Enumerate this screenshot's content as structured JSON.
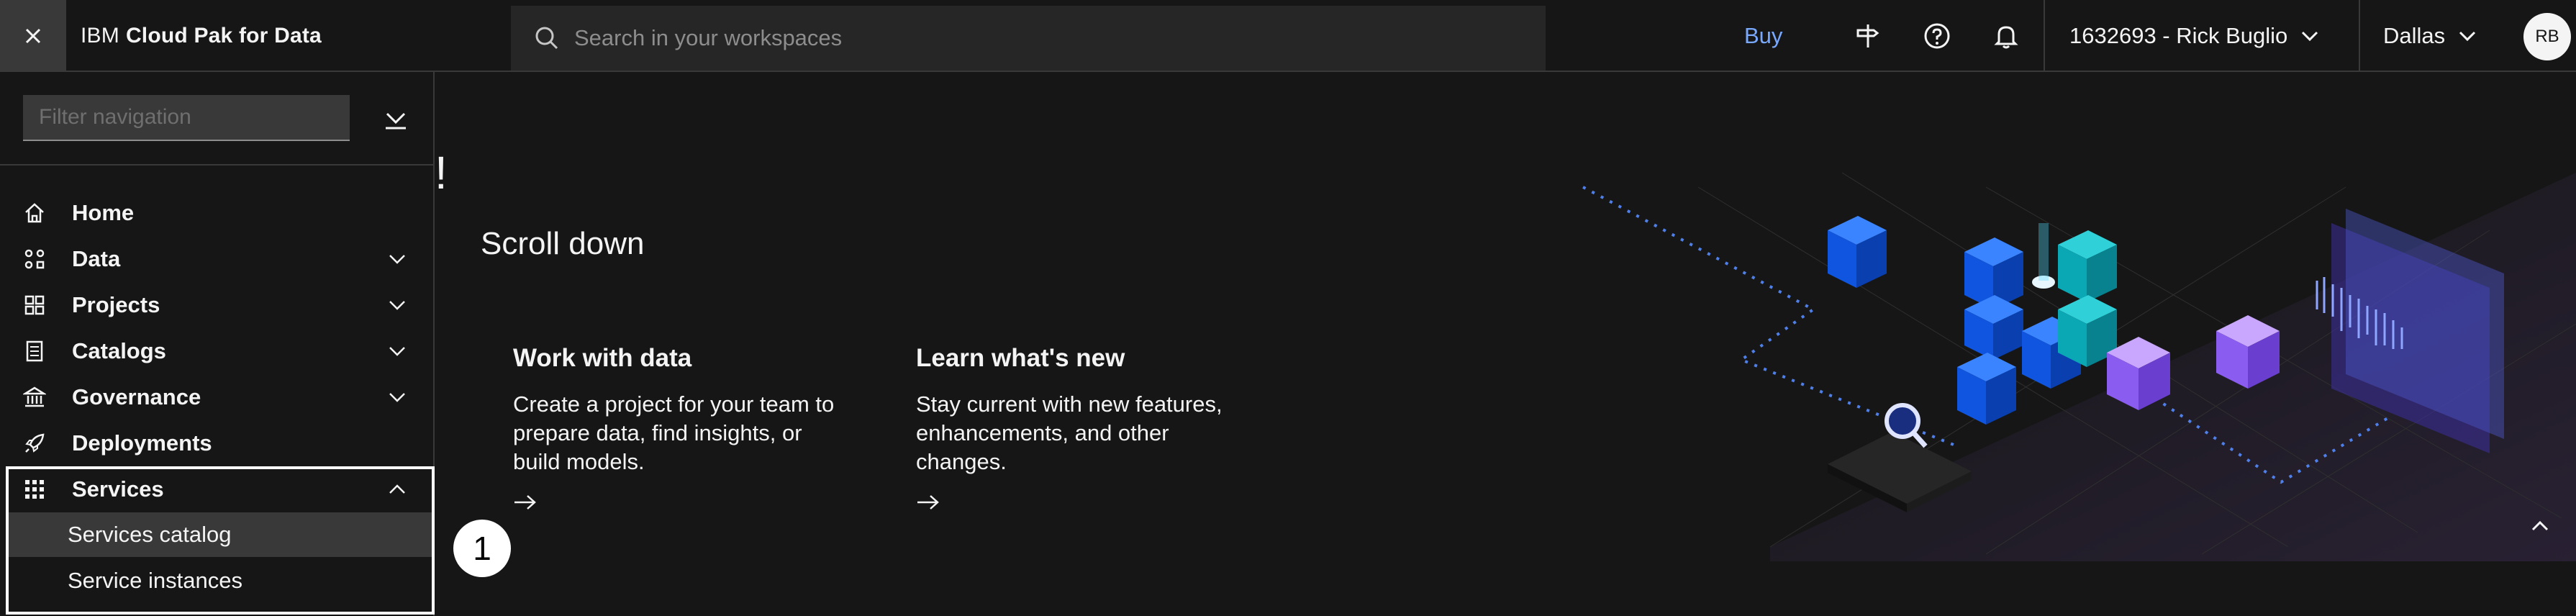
{
  "topbar": {
    "brand_prefix": "IBM",
    "brand_name": "Cloud Pak for Data",
    "search_placeholder": "Search in your workspaces",
    "buy_label": "Buy",
    "account_label": "1632693 - Rick Buglio",
    "region_label": "Dallas",
    "avatar_initials": "RB",
    "icons": [
      "close-icon",
      "search-icon",
      "signpost-icon",
      "help-icon",
      "notification-icon",
      "chevron-down-icon"
    ]
  },
  "sidebar": {
    "filter_placeholder": "Filter navigation",
    "items": [
      {
        "label": "Home",
        "icon": "home-icon"
      },
      {
        "label": "Data",
        "icon": "data-icon"
      },
      {
        "label": "Projects",
        "icon": "projects-icon"
      },
      {
        "label": "Catalogs",
        "icon": "catalog-icon"
      },
      {
        "label": "Governance",
        "icon": "governance-icon"
      },
      {
        "label": "Deployments",
        "icon": "rocket-icon"
      },
      {
        "label": "Services",
        "icon": "grid-icon"
      }
    ],
    "services_sub": [
      {
        "label": "Services catalog",
        "active": true
      },
      {
        "label": "Service instances",
        "active": false
      }
    ]
  },
  "main": {
    "exclaim": "!",
    "scroll_hint": "Scroll down",
    "cards": [
      {
        "title": "Work with data",
        "description": "Create a project for your team to prepare data, find insights, or build models."
      },
      {
        "title": "Learn what's new",
        "description": "Stay current with new features, enhancements, and other changes."
      }
    ],
    "step_badge": "1"
  },
  "colors": {
    "background": "#161616",
    "panel": "#262626",
    "border": "#393939",
    "link": "#78a9ff",
    "text": "#f4f4f4"
  }
}
